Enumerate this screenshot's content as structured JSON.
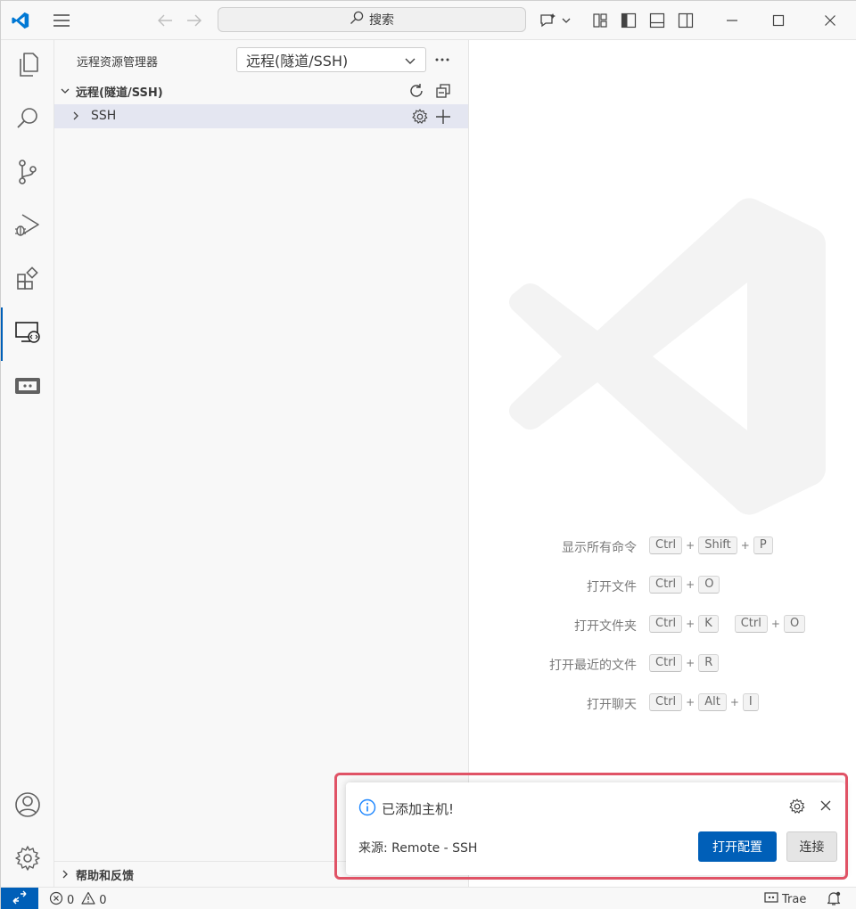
{
  "titlebar": {
    "search_placeholder": "搜索"
  },
  "activitybar": {
    "items": [
      "explorer-icon",
      "search-icon",
      "source-control-icon",
      "run-debug-icon",
      "extensions-icon",
      "remote-explorer-icon",
      "remote-tunnel-icon"
    ],
    "bottom": [
      "account-icon",
      "manage-gear-icon"
    ]
  },
  "sidebar": {
    "title": "远程资源管理器",
    "selected_remote": "远程(隧道/SSH)",
    "section": "远程(隧道/SSH)",
    "tree": [
      {
        "label": "SSH"
      }
    ],
    "footer_section": "帮助和反馈"
  },
  "editor": {
    "shortcuts": [
      {
        "label": "显示所有命令",
        "keys": [
          [
            "Ctrl",
            "Shift",
            "P"
          ]
        ]
      },
      {
        "label": "打开文件",
        "keys": [
          [
            "Ctrl",
            "O"
          ]
        ]
      },
      {
        "label": "打开文件夹",
        "keys": [
          [
            "Ctrl",
            "K"
          ],
          [
            "Ctrl",
            "O"
          ]
        ]
      },
      {
        "label": "打开最近的文件",
        "keys": [
          [
            "Ctrl",
            "R"
          ]
        ]
      },
      {
        "label": "打开聊天",
        "keys": [
          [
            "Ctrl",
            "Alt",
            "I"
          ]
        ]
      }
    ]
  },
  "notification": {
    "message": "已添加主机!",
    "source": "来源: Remote - SSH",
    "primary_button": "打开配置",
    "secondary_button": "连接"
  },
  "statusbar": {
    "errors": "0",
    "warnings": "0",
    "extension_label": "Trae"
  },
  "colors": {
    "accent": "#005fb8",
    "highlight_outline": "#e05366",
    "selection": "#e4e6f1"
  }
}
